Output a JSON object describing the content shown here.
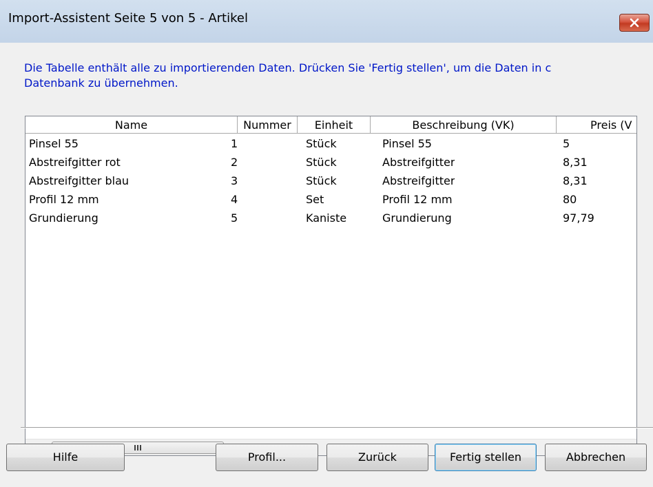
{
  "window": {
    "title": "Import-Assistent Seite 5 von 5 - Artikel",
    "close_icon": "close-icon",
    "close_color": "#c9452c"
  },
  "intro": {
    "line1": "Die Tabelle enthält alle zu importierenden Daten. Drücken Sie 'Fertig stellen', um die Daten in c",
    "line2": "Datenbank zu übernehmen.",
    "color": "#0017c8"
  },
  "table": {
    "columns": [
      "Name",
      "Nummer",
      "Einheit",
      "Beschreibung (VK)",
      "Preis (V"
    ],
    "rows": [
      [
        "Pinsel 55",
        "1",
        "Stück",
        "Pinsel 55",
        "5"
      ],
      [
        "Abstreifgitter rot",
        "2",
        "Stück",
        "Abstreifgitter",
        "8,31"
      ],
      [
        "Abstreifgitter blau",
        "3",
        "Stück",
        "Abstreifgitter",
        "8,31"
      ],
      [
        "Profil 12 mm",
        "4",
        "Set",
        "Profil 12 mm",
        "80"
      ],
      [
        "Grundierung",
        "5",
        "Kaniste",
        "Grundierung",
        "97,79"
      ]
    ],
    "scrollbar": {
      "left_icon": "scroll-left-icon",
      "right_icon": "scroll-right-icon",
      "grip_icon": "grip-icon",
      "grip_glyph": "III"
    }
  },
  "buttons": {
    "help": "Hilfe",
    "profile": "Profil...",
    "back": "Zurück",
    "finish": "Fertig stellen",
    "cancel": "Abbrechen"
  }
}
